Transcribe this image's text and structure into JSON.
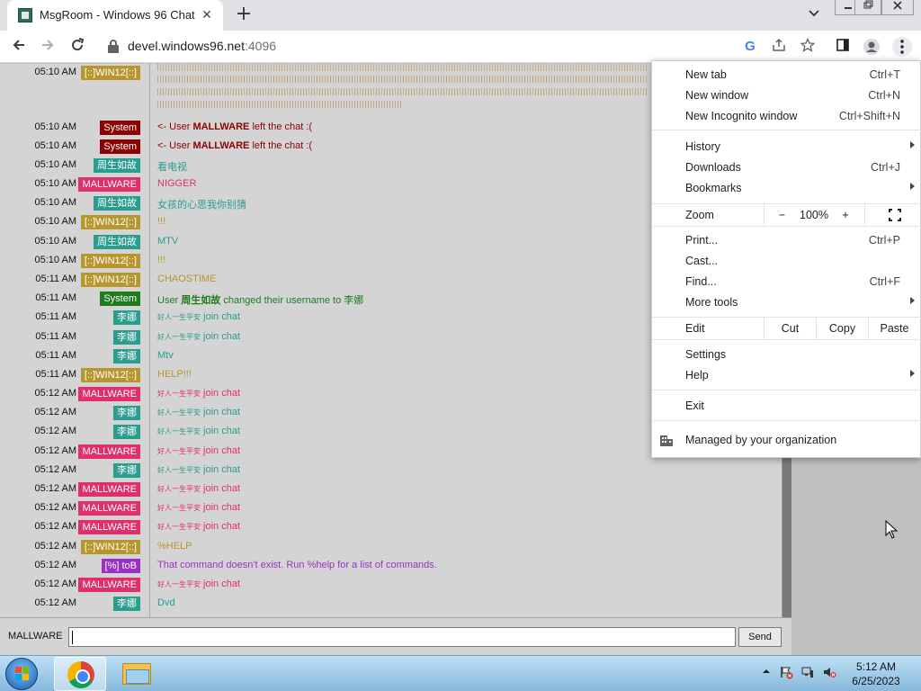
{
  "browser": {
    "tab_title": "MsgRoom - Windows 96 Chat",
    "tab_close": "✕",
    "new_tab": "+",
    "url_host": "devel.windows96.net",
    "url_port": ":4096"
  },
  "chat": {
    "messages": [
      {
        "time": "05:10 AM",
        "user": "[::]WIN12[::]",
        "color": "#b8962e",
        "pre": "",
        "text": "",
        "bold": "",
        "post": "",
        "text_color": "#b8962e"
      },
      {
        "time": "05:10 AM",
        "user": "System",
        "color": "#8b0000",
        "pre": "",
        "text": "<- User ",
        "bold": "MALLWARE",
        "post": " left the chat :(",
        "text_color": "#8b0000"
      },
      {
        "time": "05:10 AM",
        "user": "System",
        "color": "#8b0000",
        "pre": "",
        "text": "<- User ",
        "bold": "MALLWARE",
        "post": " left the chat :(",
        "text_color": "#8b0000"
      },
      {
        "time": "05:10 AM",
        "user": "周生如故",
        "color": "#2a9d8f",
        "pre": "",
        "text": "看电视",
        "bold": "",
        "post": "",
        "text_color": "#2a9d8f"
      },
      {
        "time": "05:10 AM",
        "user": "MALLWARE",
        "color": "#e0306a",
        "pre": "",
        "text": "NIGGER",
        "bold": "",
        "post": "",
        "text_color": "#e0306a"
      },
      {
        "time": "05:10 AM",
        "user": "周生如故",
        "color": "#2a9d8f",
        "pre": "",
        "text": "女孩的心思我你别猜",
        "bold": "",
        "post": "",
        "text_color": "#2a9d8f"
      },
      {
        "time": "05:10 AM",
        "user": "[::]WIN12[::]",
        "color": "#b8962e",
        "pre": "",
        "text": "!!!",
        "bold": "",
        "post": "",
        "text_color": "#b8962e"
      },
      {
        "time": "05:10 AM",
        "user": "周生如故",
        "color": "#2a9d8f",
        "pre": "",
        "text": "MTV",
        "bold": "",
        "post": "",
        "text_color": "#2a9d8f"
      },
      {
        "time": "05:10 AM",
        "user": "[::]WIN12[::]",
        "color": "#b8962e",
        "pre": "",
        "text": "!!!",
        "bold": "",
        "post": "",
        "text_color": "#b8962e"
      },
      {
        "time": "05:11 AM",
        "user": "[::]WIN12[::]",
        "color": "#b8962e",
        "pre": "",
        "text": "CHAOSTIME",
        "bold": "",
        "post": "",
        "text_color": "#b8962e"
      },
      {
        "time": "05:11 AM",
        "user": "System",
        "color": "#1e7b1e",
        "pre": "",
        "text": "User ",
        "bold": "周生如故",
        "post": " changed their username to 李娜",
        "text_color": "#1e7b1e"
      },
      {
        "time": "05:11 AM",
        "user": "李娜",
        "color": "#2a9d8f",
        "pre": "好人一生平安",
        "text": " join chat",
        "bold": "",
        "post": "",
        "text_color": "#2a9d8f"
      },
      {
        "time": "05:11 AM",
        "user": "李娜",
        "color": "#2a9d8f",
        "pre": "好人一生平安",
        "text": " join chat",
        "bold": "",
        "post": "",
        "text_color": "#2a9d8f"
      },
      {
        "time": "05:11 AM",
        "user": "李娜",
        "color": "#2a9d8f",
        "pre": "",
        "text": "Mtv",
        "bold": "",
        "post": "",
        "text_color": "#2a9d8f"
      },
      {
        "time": "05:11 AM",
        "user": "[::]WIN12[::]",
        "color": "#b8962e",
        "pre": "",
        "text": "HELP!!!",
        "bold": "",
        "post": "",
        "text_color": "#b8962e"
      },
      {
        "time": "05:12 AM",
        "user": "MALLWARE",
        "color": "#e0306a",
        "pre": "好人一生平安",
        "text": " join chat",
        "bold": "",
        "post": "",
        "text_color": "#e0306a"
      },
      {
        "time": "05:12 AM",
        "user": "李娜",
        "color": "#2a9d8f",
        "pre": "好人一生平安",
        "text": " join chat",
        "bold": "",
        "post": "",
        "text_color": "#2a9d8f"
      },
      {
        "time": "05:12 AM",
        "user": "李娜",
        "color": "#2a9d8f",
        "pre": "好人一生平安",
        "text": " join chat",
        "bold": "",
        "post": "",
        "text_color": "#2a9d8f"
      },
      {
        "time": "05:12 AM",
        "user": "MALLWARE",
        "color": "#e0306a",
        "pre": "好人一生平安",
        "text": " join chat",
        "bold": "",
        "post": "",
        "text_color": "#e0306a"
      },
      {
        "time": "05:12 AM",
        "user": "李娜",
        "color": "#2a9d8f",
        "pre": "好人一生平安",
        "text": " join chat",
        "bold": "",
        "post": "",
        "text_color": "#2a9d8f"
      },
      {
        "time": "05:12 AM",
        "user": "MALLWARE",
        "color": "#e0306a",
        "pre": "好人一生平安",
        "text": " join chat",
        "bold": "",
        "post": "",
        "text_color": "#e0306a"
      },
      {
        "time": "05:12 AM",
        "user": "MALLWARE",
        "color": "#e0306a",
        "pre": "好人一生平安",
        "text": " join chat",
        "bold": "",
        "post": "",
        "text_color": "#e0306a"
      },
      {
        "time": "05:12 AM",
        "user": "MALLWARE",
        "color": "#e0306a",
        "pre": "好人一生平安",
        "text": " join chat",
        "bold": "",
        "post": "",
        "text_color": "#e0306a"
      },
      {
        "time": "05:12 AM",
        "user": "[::]WIN12[::]",
        "color": "#b8962e",
        "pre": "",
        "text": "%HELP",
        "bold": "",
        "post": "",
        "text_color": "#b8962e"
      },
      {
        "time": "05:12 AM",
        "user": "[%] toB",
        "color": "#9b30c8",
        "pre": "",
        "text": "That command doesn't exist. Run %help for a list of commands.",
        "bold": "",
        "post": "",
        "text_color": "#9b30c8"
      },
      {
        "time": "05:12 AM",
        "user": "MALLWARE",
        "color": "#e0306a",
        "pre": "好人一生平安",
        "text": " join chat",
        "bold": "",
        "post": "",
        "text_color": "#e0306a"
      },
      {
        "time": "05:12 AM",
        "user": "李娜",
        "color": "#2a9d8f",
        "pre": "",
        "text": "Dvd",
        "bold": "",
        "post": "",
        "text_color": "#2a9d8f"
      }
    ],
    "input": {
      "username": "MALLWARE",
      "value": "",
      "send_label": "Send"
    }
  },
  "menu": {
    "new_tab": {
      "label": "New tab",
      "shortcut": "Ctrl+T"
    },
    "new_window": {
      "label": "New window",
      "shortcut": "Ctrl+N"
    },
    "new_incognito": {
      "label": "New Incognito window",
      "shortcut": "Ctrl+Shift+N"
    },
    "history": {
      "label": "History"
    },
    "downloads": {
      "label": "Downloads",
      "shortcut": "Ctrl+J"
    },
    "bookmarks": {
      "label": "Bookmarks"
    },
    "zoom": {
      "label": "Zoom",
      "minus": "−",
      "value": "100%",
      "plus": "+"
    },
    "print": {
      "label": "Print...",
      "shortcut": "Ctrl+P"
    },
    "cast": {
      "label": "Cast..."
    },
    "find": {
      "label": "Find...",
      "shortcut": "Ctrl+F"
    },
    "more_tools": {
      "label": "More tools"
    },
    "edit": {
      "label": "Edit",
      "cut": "Cut",
      "copy": "Copy",
      "paste": "Paste"
    },
    "settings": {
      "label": "Settings"
    },
    "help": {
      "label": "Help"
    },
    "exit": {
      "label": "Exit"
    },
    "managed": {
      "label": "Managed by your organization"
    }
  },
  "taskbar": {
    "time": "5:12 AM",
    "date": "6/25/2023"
  }
}
